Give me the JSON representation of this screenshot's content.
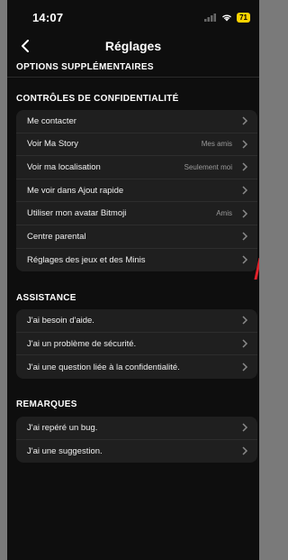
{
  "status": {
    "time": "14:07",
    "battery": "71"
  },
  "header": {
    "title": "Réglages"
  },
  "sections": {
    "top": "OPTIONS SUPPLÉMENTAIRES",
    "privacy": "CONTRÔLES DE CONFIDENTIALITÉ",
    "support": "ASSISTANCE",
    "feedback": "REMARQUES"
  },
  "privacy_rows": [
    {
      "label": "Me contacter",
      "value": ""
    },
    {
      "label": "Voir Ma Story",
      "value": "Mes amis"
    },
    {
      "label": "Voir ma localisation",
      "value": "Seulement moi"
    },
    {
      "label": "Me voir dans Ajout rapide",
      "value": ""
    },
    {
      "label": "Utiliser mon avatar Bitmoji",
      "value": "Amis"
    },
    {
      "label": "Centre parental",
      "value": ""
    },
    {
      "label": "Réglages des jeux et des Minis",
      "value": ""
    }
  ],
  "support_rows": [
    {
      "label": "J'ai besoin d'aide."
    },
    {
      "label": "J'ai un problème de sécurité."
    },
    {
      "label": "J'ai une question liée à la confidentialité."
    }
  ],
  "feedback_rows": [
    {
      "label": "J'ai repéré un bug."
    },
    {
      "label": "J'ai une suggestion."
    }
  ],
  "colors": {
    "background": "#0e0e0e",
    "card": "#1f1f1f",
    "battery": "#ffd400"
  }
}
